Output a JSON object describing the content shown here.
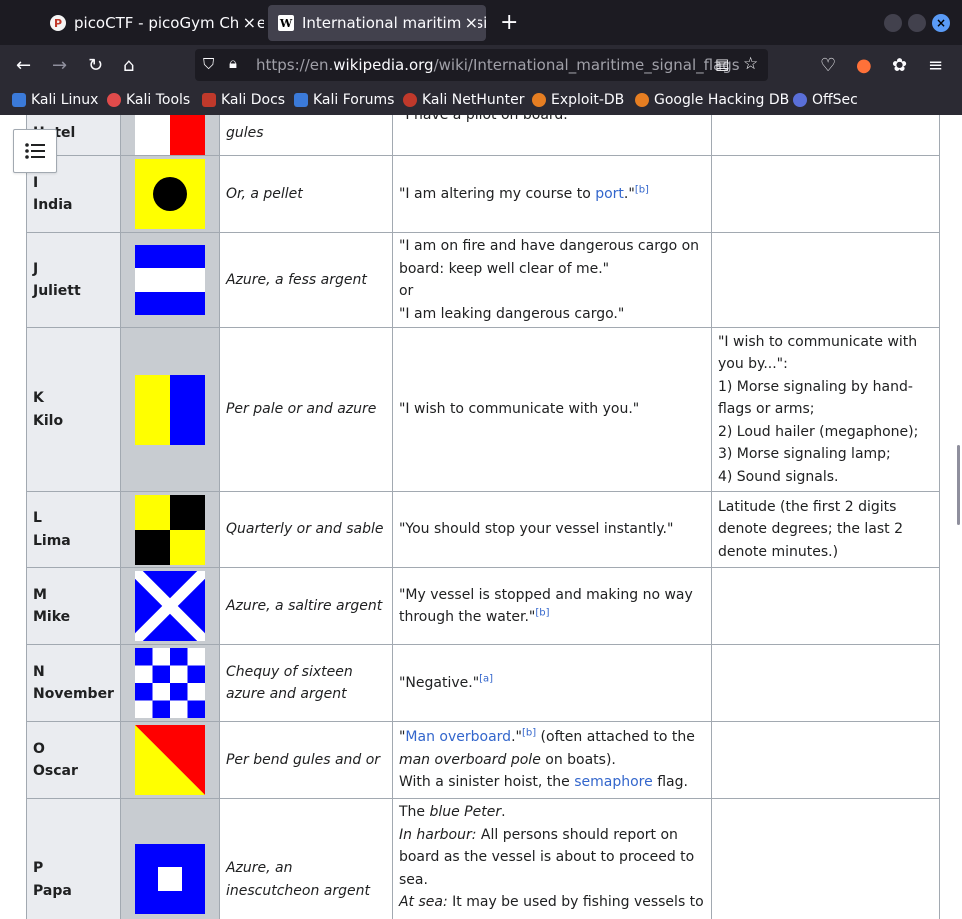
{
  "tabs": [
    {
      "title": "picoCTF - picoGym Challe",
      "favicon": "picoctf-icon"
    },
    {
      "title": "International maritime sig",
      "favicon": "wikipedia-icon"
    }
  ],
  "url": {
    "prefix": "https://en.",
    "domain": "wikipedia.org",
    "path": "/wiki/International_maritime_signal_flags"
  },
  "bookmarks": [
    "Kali Linux",
    "Kali Tools",
    "Kali Docs",
    "Kali Forums",
    "Kali NetHunter",
    "Exploit-DB",
    "Google Hacking DB",
    "OffSec"
  ],
  "rows": [
    {
      "letter": "",
      "name": "Hotel",
      "heraldry": "gules",
      "meaning": "\"I have a pilot on board.\"",
      "notes": ""
    },
    {
      "letter": "I",
      "name": "India",
      "heraldry": "Or, a pellet",
      "meaning_pre": "\"I am altering my course to ",
      "meaning_link": "port",
      "meaning_post": ".\"",
      "meaning_ref": "[b]",
      "notes": ""
    },
    {
      "letter": "J",
      "name": "Juliett",
      "heraldry": "Azure, a fess argent",
      "meaning_lines": [
        "\"I am on fire and have dangerous cargo on board: keep well clear of me.\"",
        "or",
        "\"I am leaking dangerous cargo.\""
      ],
      "notes": ""
    },
    {
      "letter": "K",
      "name": "Kilo",
      "heraldry": "Per pale or and azure",
      "meaning": "\"I wish to communicate with you.\"",
      "notes_lines": [
        "\"I wish to communicate with you by...\":",
        "1) Morse signaling by hand-flags or arms;",
        "2) Loud hailer (megaphone);",
        "3) Morse signaling lamp;",
        "4) Sound signals."
      ]
    },
    {
      "letter": "L",
      "name": "Lima",
      "heraldry": "Quarterly or and sable",
      "meaning": "\"You should stop your vessel instantly.\"",
      "notes": "Latitude (the first 2 digits denote degrees; the last 2 denote minutes.)"
    },
    {
      "letter": "M",
      "name": "Mike",
      "heraldry": "Azure, a saltire argent",
      "meaning": "\"My vessel is stopped and making no way through the water.\"",
      "meaning_ref": "[b]",
      "notes": ""
    },
    {
      "letter": "N",
      "name": "November",
      "heraldry": "Chequy of sixteen azure and argent",
      "meaning": "\"Negative.\"",
      "meaning_ref": "[a]",
      "notes": ""
    },
    {
      "letter": "O",
      "name": "Oscar",
      "heraldry": "Per bend gules and or",
      "meaning_quote": "\"",
      "meaning_link": "Man overboard",
      "meaning_post": ".\"",
      "meaning_ref": "[b]",
      "meaning_rest": " (often attached to the ",
      "meaning_italic": "man overboard pole",
      "meaning_rest2": " on boats).",
      "meaning_line2_pre": "With a sinister hoist, the ",
      "meaning_line2_link": "semaphore",
      "meaning_line2_post": " flag.",
      "notes": ""
    },
    {
      "letter": "P",
      "name": "Papa",
      "heraldry": "Azure, an inescutcheon argent",
      "meaning_p1_pre": "The ",
      "meaning_p1_italic": "blue Peter",
      "meaning_p1_post": ".",
      "meaning_p2_label": "In harbour:",
      "meaning_p2_text": " All persons should report on board as the vessel is about to proceed to sea.",
      "meaning_p3_label": "At sea:",
      "meaning_p3_text": " It may be used by fishing vessels to",
      "notes": ""
    }
  ],
  "colors": {
    "red": "#ff0000",
    "yellow": "#ffff00",
    "blue": "#0000ff",
    "black": "#000000",
    "white": "#ffffff",
    "link": "#3366cc"
  }
}
